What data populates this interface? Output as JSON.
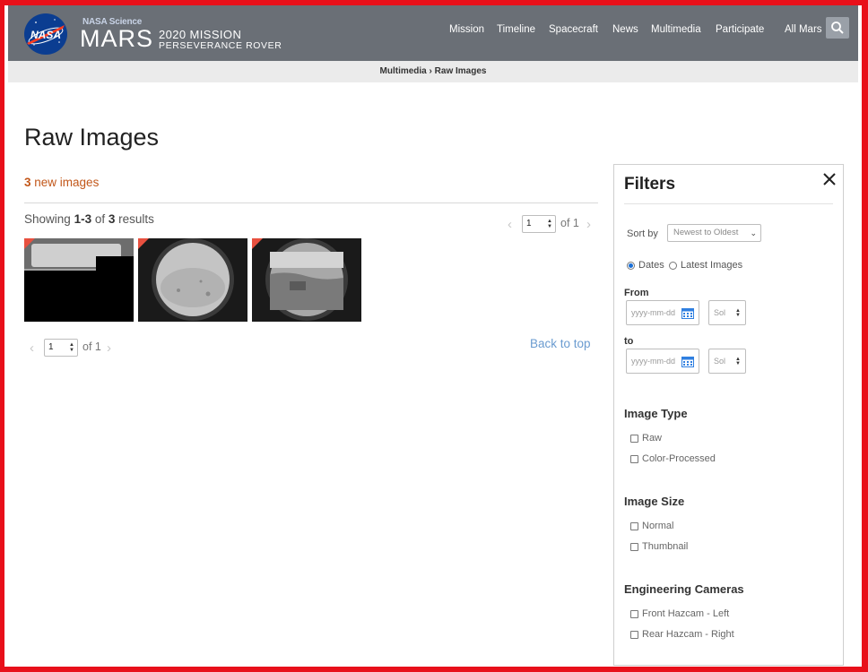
{
  "header": {
    "brand_small": "NASA Science",
    "brand_name": "MARS",
    "mission_line": "2020 MISSION",
    "rover_line": "PERSEVERANCE ROVER",
    "nav": [
      "Mission",
      "Timeline",
      "Spacecraft",
      "News",
      "Multimedia",
      "Participate",
      "All Mars"
    ]
  },
  "breadcrumb": {
    "parent": "Multimedia",
    "separator": "›",
    "current": "Raw Images"
  },
  "page": {
    "title": "Raw Images",
    "new_count": "3",
    "new_label": "new images",
    "showing_prefix": "Showing",
    "showing_range": "1-3",
    "showing_of": "of",
    "showing_total": "3",
    "showing_suffix": "results",
    "back_to_top": "Back to top"
  },
  "pagination": {
    "page": "1",
    "of_label": "of 1"
  },
  "thumbnails": [
    {
      "alt": "Raw image 1"
    },
    {
      "alt": "Raw image 2"
    },
    {
      "alt": "Raw image 3"
    }
  ],
  "filters": {
    "title": "Filters",
    "sort_label": "Sort by",
    "sort_value": "Newest to Oldest",
    "radio_dates": "Dates",
    "radio_latest": "Latest Images",
    "from_label": "From",
    "to_label": "to",
    "date_placeholder": "yyyy-mm-dd",
    "sol_placeholder": "Sol",
    "image_type_title": "Image Type",
    "image_type_options": [
      "Raw",
      "Color-Processed"
    ],
    "image_size_title": "Image Size",
    "image_size_options": [
      "Normal",
      "Thumbnail"
    ],
    "cameras_title": "Engineering Cameras",
    "cameras_options": [
      "Front Hazcam - Left",
      "Rear Hazcam - Right"
    ]
  },
  "colors": {
    "accent_new": "#c2571a",
    "link": "#6a9bd0",
    "header_bg": "#6a6f76",
    "frame": "#e8101a"
  }
}
